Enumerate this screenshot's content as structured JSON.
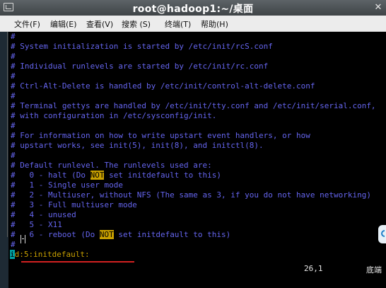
{
  "window": {
    "title": "root@hadoop1:~/桌面"
  },
  "menu": [
    {
      "label": "文件(F)"
    },
    {
      "label": "编辑(E)"
    },
    {
      "label": "查看(V)"
    },
    {
      "label": "搜索 (S)"
    },
    {
      "label": "终端(T)"
    },
    {
      "label": "帮助(H)"
    }
  ],
  "lines": [
    {
      "text": "#"
    },
    {
      "text": "# System initialization is started by /etc/init/rcS.conf"
    },
    {
      "text": "#"
    },
    {
      "text": "# Individual runlevels are started by /etc/init/rc.conf"
    },
    {
      "text": "#"
    },
    {
      "text": "# Ctrl-Alt-Delete is handled by /etc/init/control-alt-delete.conf"
    },
    {
      "text": "#"
    },
    {
      "text": "# Terminal gettys are handled by /etc/init/tty.conf and /etc/init/serial.conf,"
    },
    {
      "text": "# with configuration in /etc/sysconfig/init."
    },
    {
      "text": "#"
    },
    {
      "text": "# For information on how to write upstart event handlers, or how"
    },
    {
      "text": "# upstart works, see init(5), init(8), and initctl(8)."
    },
    {
      "text": "#"
    },
    {
      "text": "# Default runlevel. The runlevels used are:"
    },
    {
      "a": "#   0 - halt (Do ",
      "b": "NOT",
      "c": " set initdefault to this)"
    },
    {
      "text": "#   1 - Single user mode"
    },
    {
      "text": "#   2 - Multiuser, without NFS (The same as 3, if you do not have networking)"
    },
    {
      "text": "#   3 - Full multiuser mode"
    },
    {
      "text": "#   4 - unused"
    },
    {
      "text": "#   5 - X11"
    },
    {
      "a": "#   6 - reboot (Do ",
      "b": "NOT",
      "c": " set initdefault to this)"
    },
    {
      "text": "#"
    },
    {
      "a": "i",
      "b": "d:5:initdefault:"
    }
  ],
  "status": {
    "position": "26,1",
    "scroll": "底端"
  },
  "colors": {
    "comment": "#6565ee",
    "highlight": "#c8a000",
    "cursor": "#00a0a0",
    "annotation": "#d22020"
  },
  "icons": [
    "terminal-window-icon",
    "close-icon",
    "text-cursor-icon"
  ]
}
